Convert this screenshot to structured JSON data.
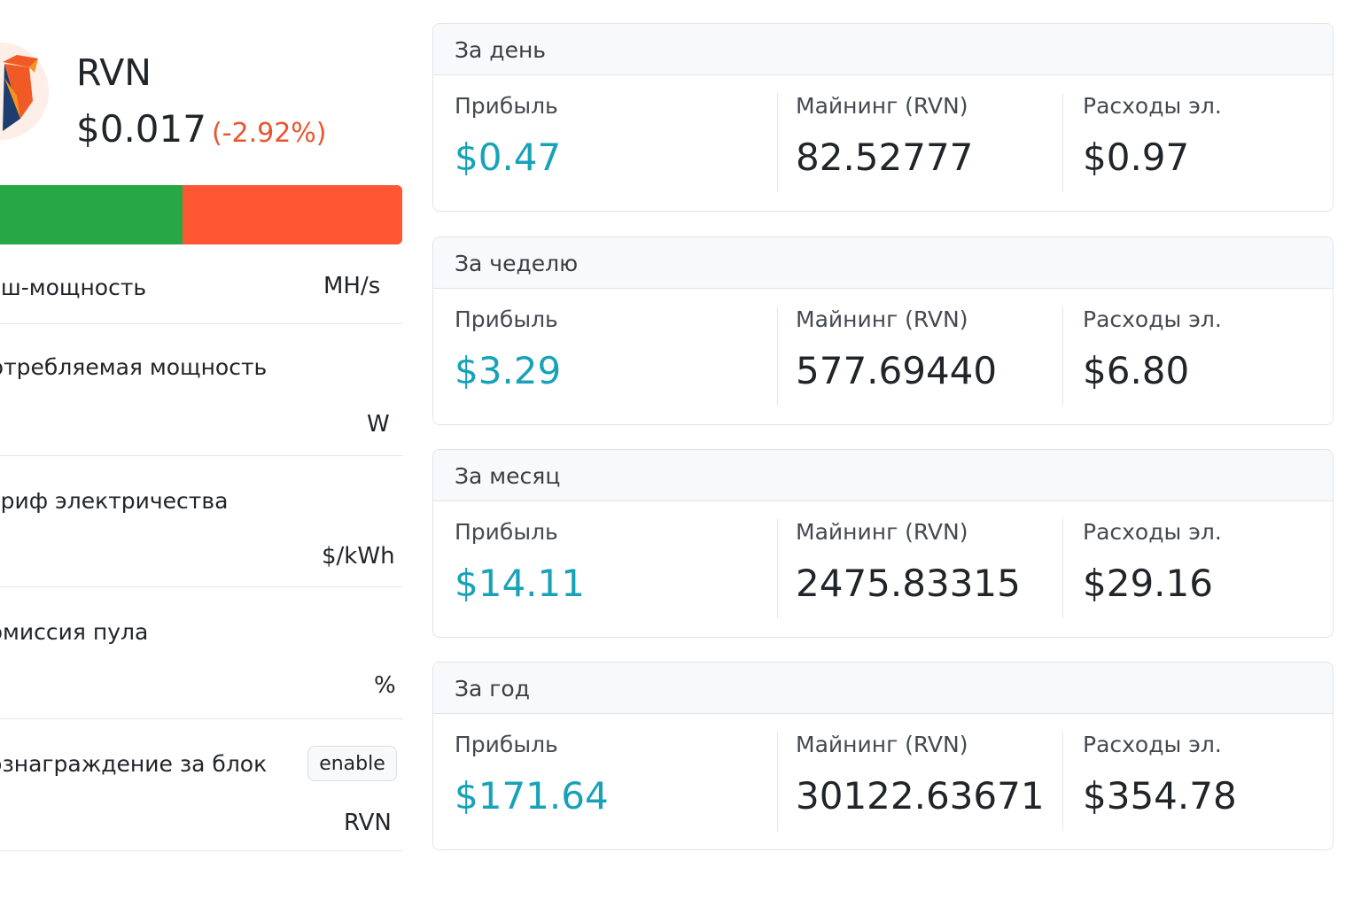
{
  "coin": {
    "name": "RVN",
    "price": "$0.017",
    "change": "(-2.92%)",
    "logo_icon": "ravencoin-logo-icon"
  },
  "profit_bar": {
    "profit_fraction": 0.465,
    "profit_color": "#28a745",
    "cost_color": "#ff5733"
  },
  "params": [
    {
      "label": "Хэш-мощность",
      "unit": "MH/s"
    },
    {
      "label": "Потребляемая мощность",
      "unit": "W"
    },
    {
      "label": "Тариф электричества",
      "unit": "$/kWh"
    },
    {
      "label": "Комиссия пула",
      "unit": "%"
    },
    {
      "label": "Вознаграждение за блок",
      "unit": "RVN",
      "toggle": "enable"
    }
  ],
  "colors": {
    "profit": "#17a2b8",
    "negative": "#e8552f"
  },
  "periods": [
    {
      "title": "За день",
      "profit_label": "Прибыль",
      "profit": "$0.47",
      "mining_label": "Майнинг (RVN)",
      "mining": "82.52777",
      "cost_label": "Расходы эл.",
      "cost": "$0.97"
    },
    {
      "title": "За чеделю",
      "profit_label": "Прибыль",
      "profit": "$3.29",
      "mining_label": "Майнинг (RVN)",
      "mining": "577.69440",
      "cost_label": "Расходы эл.",
      "cost": "$6.80"
    },
    {
      "title": "За месяц",
      "profit_label": "Прибыль",
      "profit": "$14.11",
      "mining_label": "Майнинг (RVN)",
      "mining": "2475.83315",
      "cost_label": "Расходы эл.",
      "cost": "$29.16"
    },
    {
      "title": "За год",
      "profit_label": "Прибыль",
      "profit": "$171.64",
      "mining_label": "Майнинг (RVN)",
      "mining": "30122.63671",
      "cost_label": "Расходы эл.",
      "cost": "$354.78"
    }
  ]
}
